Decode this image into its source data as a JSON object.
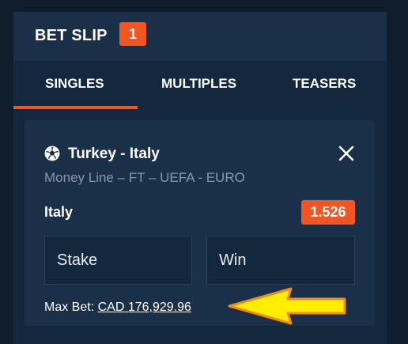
{
  "header": {
    "title": "BET SLIP",
    "count": "1"
  },
  "tabs": [
    {
      "label": "SINGLES",
      "active": true
    },
    {
      "label": "MULTIPLES",
      "active": false
    },
    {
      "label": "TEASERS",
      "active": false
    }
  ],
  "bet": {
    "sport_icon": "soccer-ball-icon",
    "event": "Turkey - Italy",
    "market": "Money Line – FT – UEFA - EURO",
    "selection": "Italy",
    "odds": "1.526",
    "stake_placeholder": "Stake",
    "win_placeholder": "Win",
    "max_bet_label": "Max Bet:",
    "max_bet_value": "CAD 176,929.96"
  },
  "colors": {
    "accent": "#f05522",
    "background": "#0f1d2c",
    "panel": "#14283d",
    "card": "#1a3048",
    "muted_text": "#8a97a6",
    "annotation_arrow": "#ffee00"
  }
}
